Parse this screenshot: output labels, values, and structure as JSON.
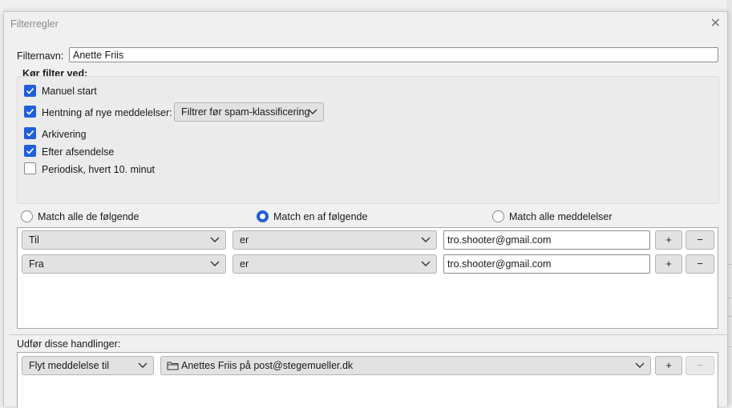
{
  "dialog": {
    "title": "Filterregler"
  },
  "filter_name": {
    "label": "Filternavn:",
    "value": "Anette Friis"
  },
  "run_filter": {
    "heading": "Kør filter ved:",
    "options": [
      {
        "label": "Manuel start",
        "checked": true
      },
      {
        "label": "Hentning af nye meddelelser:",
        "checked": true
      },
      {
        "label": "Arkivering",
        "checked": true
      },
      {
        "label": "Efter afsendelse",
        "checked": true
      },
      {
        "label": "Periodisk, hvert 10. minut",
        "checked": false
      }
    ],
    "spam_select": "Filtrer før spam-klassificering"
  },
  "match": {
    "options": [
      {
        "label": "Match alle de følgende",
        "selected": false
      },
      {
        "label": "Match en af følgende",
        "selected": true
      },
      {
        "label": "Match alle meddelelser",
        "selected": false
      }
    ]
  },
  "rules": [
    {
      "field": "Til",
      "operator": "er",
      "value": "tro.shooter@gmail.com",
      "add": "+",
      "remove": "−"
    },
    {
      "field": "Fra",
      "operator": "er",
      "value": "tro.shooter@gmail.com",
      "add": "+",
      "remove": "−"
    }
  ],
  "actions": {
    "heading": "Udfør disse handlinger:",
    "items": [
      {
        "action": "Flyt meddelelse til",
        "target": "Anettes Friis på post@stegemueller.dk",
        "add": "+",
        "remove": "−"
      }
    ]
  },
  "icons": {
    "close": "close-icon",
    "chevron": "chevron-down-icon",
    "folder": "folder-icon",
    "check": "checkmark-icon"
  },
  "colors": {
    "accent": "#1f5fd8",
    "background": "#f0f0f0"
  }
}
